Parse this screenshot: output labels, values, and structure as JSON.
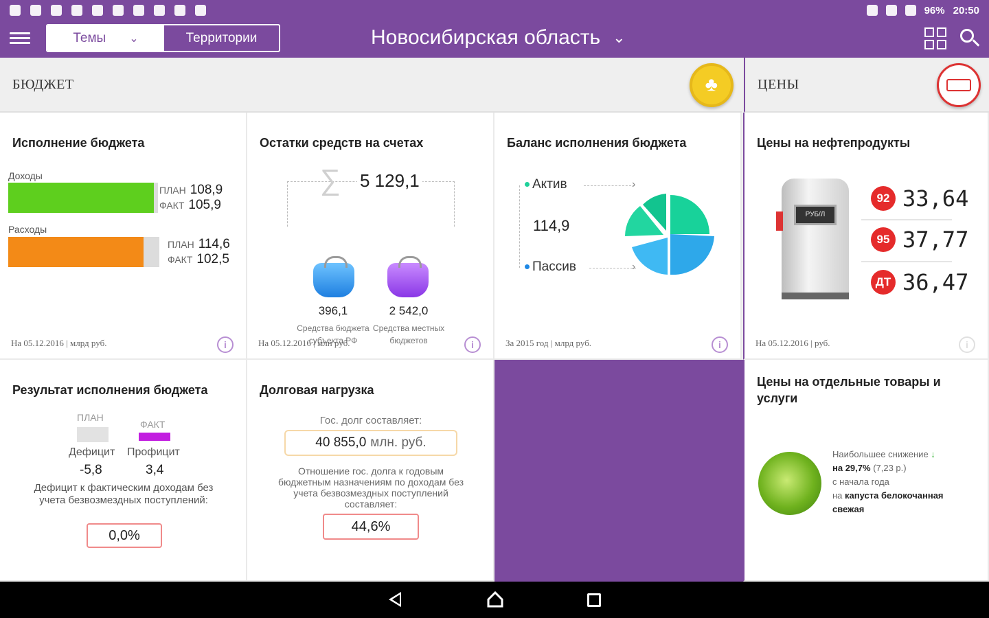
{
  "status": {
    "time": "20:50",
    "battery": "96%"
  },
  "header": {
    "tabs": [
      {
        "label": "Темы"
      },
      {
        "label": "Территории"
      }
    ],
    "region": "Новосибирская область"
  },
  "sections": {
    "budget": {
      "title": "БЮДЖЕТ"
    },
    "prices": {
      "title": "ЦЕНЫ"
    }
  },
  "cards": {
    "execution": {
      "title": "Исполнение бюджета",
      "income_label": "Доходы",
      "expense_label": "Расходы",
      "plan_label": "ПЛАН",
      "fact_label": "ФАКТ",
      "income_plan": "108,9",
      "income_fact": "105,9",
      "expense_plan": "114,6",
      "expense_fact": "102,5",
      "income_ratio": 0.972,
      "expense_ratio": 0.894,
      "colors": {
        "income": "#5ecf1e",
        "expense": "#f38a17"
      },
      "footer": "На 05.12.2016 | млрд руб."
    },
    "balances": {
      "title": "Остатки средств на счетах",
      "total": "5 129,1",
      "left_value": "396,1",
      "left_desc": "Средства бюджета субъекта РФ",
      "right_value": "2 542,0",
      "right_desc": "Средства местных бюджетов",
      "footer": "На 05.12.2016 | млн руб."
    },
    "balance_exec": {
      "title": "Баланс исполнения бюджета",
      "active": "Актив",
      "value": "114,9",
      "passive": "Пассив",
      "footer": "За 2015 год | млрд руб."
    },
    "fuel": {
      "title": "Цены на нефтепродукты",
      "pump_label": "РУБ/Л",
      "items": [
        {
          "grade": "92",
          "price": "33,64"
        },
        {
          "grade": "95",
          "price": "37,77"
        },
        {
          "grade": "ДТ",
          "price": "36,47"
        }
      ],
      "footer": "На 05.12.2016 | руб."
    },
    "result": {
      "title": "Результат исполнения бюджета",
      "plan_label": "ПЛАН",
      "fact_label": "ФАКТ",
      "deficit_label": "Дефицит",
      "surplus_label": "Профицит",
      "deficit_value": "-5,8",
      "surplus_value": "3,4",
      "note": "Дефицит к фактическим доходам без учета безвозмездных поступлений:",
      "ratio": "0,0%"
    },
    "debt": {
      "title": "Долговая нагрузка",
      "intro": "Гос. долг составляет:",
      "amount": "40 855,0",
      "unit": "млн. руб.",
      "note": "Отношение гос. долга к годовым бюджетным назначениям по доходам без учета безвозмездных поступлений составляет:",
      "ratio": "44,6%"
    },
    "goods": {
      "title": "Цены на отдельные товары и услуги",
      "line1": "Наибольшее снижение",
      "line2_bold": "на 29,7%",
      "line2_rest": "(7,23 р.)",
      "line3": "с начала года",
      "line4_prefix": "на",
      "product": "капуста белокочанная свежая"
    }
  },
  "colors": {
    "brand": "#7b4a9e",
    "accent": "#b88fd3",
    "fact": "#c21ee0"
  }
}
